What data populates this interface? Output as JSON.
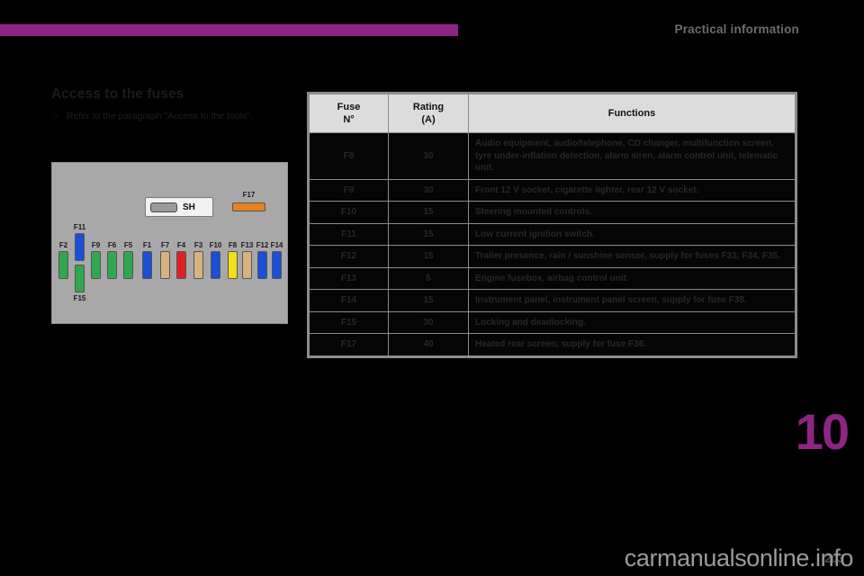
{
  "header": {
    "running_title": "Practical information",
    "accent_color": "#8E2585"
  },
  "section": {
    "title": "Access to the fuses",
    "bullet_glyph": "☞",
    "bullet_text": "Refer to the paragraph \"Access to the tools\"."
  },
  "fusebox": {
    "shunt_label": "SH",
    "fuses": [
      {
        "label": "F2",
        "color": "#2FA84F"
      },
      {
        "label": "F11",
        "color": "#1A4FD6"
      },
      {
        "label": "F15",
        "color": "#2FA84F"
      },
      {
        "label": "F9",
        "color": "#2FA84F"
      },
      {
        "label": "F6",
        "color": "#2FA84F"
      },
      {
        "label": "F5",
        "color": "#2FA84F"
      },
      {
        "label": "F1",
        "color": "#1A4FD6"
      },
      {
        "label": "F7",
        "color": "#D9B27C"
      },
      {
        "label": "F4",
        "color": "#E02020"
      },
      {
        "label": "F3",
        "color": "#D9B27C"
      },
      {
        "label": "F10",
        "color": "#1A4FD6"
      },
      {
        "label": "F8",
        "color": "#F2E215"
      },
      {
        "label": "F13",
        "color": "#D9B27C"
      },
      {
        "label": "F12",
        "color": "#1A4FD6"
      },
      {
        "label": "F14",
        "color": "#1A4FD6"
      }
    ],
    "f17": {
      "label": "F17",
      "color": "#E8821E"
    }
  },
  "table": {
    "columns": [
      "Fuse\nN°",
      "Rating\n(A)",
      "Functions"
    ],
    "col_fuse_line1": "Fuse",
    "col_fuse_line2": "N°",
    "col_rating_line1": "Rating",
    "col_rating_line2": "(A)",
    "col_functions": "Functions",
    "rows": [
      {
        "fuse": "F8",
        "rating": "30",
        "functions": "Audio equipment, audio/telephone, CD changer, multifunction screen, tyre under-inflation detection, alarm siren, alarm control unit, telematic unit."
      },
      {
        "fuse": "F9",
        "rating": "30",
        "functions": "Front 12 V socket, cigarette lighter, rear 12 V socket."
      },
      {
        "fuse": "F10",
        "rating": "15",
        "functions": "Steering mounted controls."
      },
      {
        "fuse": "F11",
        "rating": "15",
        "functions": "Low current ignition switch."
      },
      {
        "fuse": "F12",
        "rating": "15",
        "functions": "Trailer presence, rain / sunshine sensor, supply for fuses F33, F34, F35."
      },
      {
        "fuse": "F13",
        "rating": "5",
        "functions": "Engine fusebox, airbag control unit."
      },
      {
        "fuse": "F14",
        "rating": "15",
        "functions": "Instrument panel, instrument panel screen, supply for fuse F38."
      },
      {
        "fuse": "F15",
        "rating": "30",
        "functions": "Locking and deadlocking."
      },
      {
        "fuse": "F17",
        "rating": "40",
        "functions": "Heated rear screen, supply for fuse F36."
      }
    ]
  },
  "chapter": {
    "number": "10"
  },
  "footer": {
    "page_number": "203",
    "watermark": "carmanualsonline.info"
  }
}
